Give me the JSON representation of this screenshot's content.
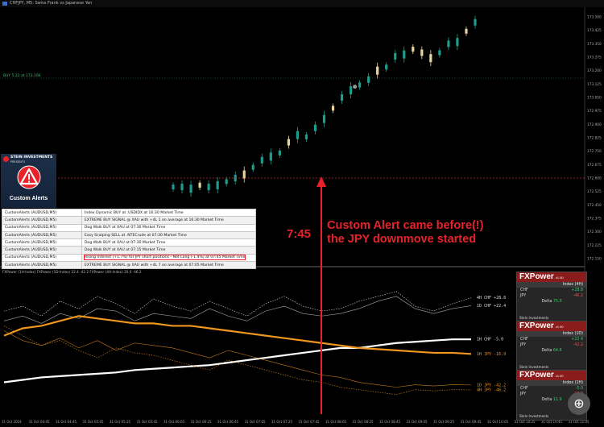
{
  "window_title": "CHFJPY, M5: Swiss Frank vs Japanese Yen",
  "price_label_buy": "BUY 5.22 at 173.106",
  "price_axis": [
    "173.500",
    "173.425",
    "173.350",
    "173.275",
    "173.200",
    "173.125",
    "173.050",
    "172.975",
    "172.900",
    "172.825",
    "172.750",
    "172.675",
    "172.600",
    "172.525",
    "172.450",
    "172.375",
    "172.300",
    "172.225",
    "172.150"
  ],
  "price_axis_values": [
    173.5,
    173.425,
    173.35,
    173.275,
    173.2,
    173.125,
    173.05,
    172.975,
    172.9,
    172.825,
    172.75,
    172.675,
    172.6,
    172.525,
    172.45,
    172.375,
    172.3,
    172.225,
    172.15
  ],
  "logo": {
    "brand": "STEIN INVESTMENTS",
    "sub": "PRESENTS",
    "label": "Custom Alerts"
  },
  "alerts": [
    {
      "source": "CustomAlerts (AUDUSD,M5)",
      "message": "Index Dynamic BUY at .USDIDX at 16:30 Market Time"
    },
    {
      "source": "CustomAlerts (AUDUSD,M5)",
      "message": "EXTREME BUY SIGNAL @ XAU with +4L 1 on average at 16:30 Market Time"
    },
    {
      "source": "CustomAlerts (AUDUSD,M5)",
      "message": "Dog Walk BUY at XAU at 07:30 Market Time"
    },
    {
      "source": "CustomAlerts (AUDUSD,M5)",
      "message": "Easy Scalping SELL at .NTECrude at 07:30 Market Time"
    },
    {
      "source": "CustomAlerts (AUDUSD,M5)",
      "message": "Dog Walk BUY at XAU at 07:30 Market Time"
    },
    {
      "source": "CustomAlerts (AUDUSD,M5)",
      "message": "Dog Walk BUY at XAU at 07:15 Market Time"
    },
    {
      "source": "CustomAlerts (AUDUSD,M5)",
      "message": "Rising Interest (+1.7%) for JPY short positions - Net Long (-1.4%) at 07:45 Market Time"
    },
    {
      "source": "CustomAlerts (AUDUSD,M5)",
      "message": "EXTREME BUY SIGNAL @ XAU with +4L 7 on average at 07:05 Market Time"
    }
  ],
  "annotation": {
    "time": "7:45",
    "line1": "Custom Alert came before(!)",
    "line2": "the JPY downmove started"
  },
  "indicator_header": "FXPower (1H-Index) FXPower (1D-Index) 22.4 -42.2 FXPower (4H-Index) 20.0 -46.2",
  "line_labels": [
    {
      "text": "4H CHF +28.8",
      "y": 28.8
    },
    {
      "text": "1D CHF +22.4",
      "y": 22.4
    },
    {
      "text": "1H CHF  -5.0",
      "y": -5.0
    },
    {
      "text": "1H JPY -16.9",
      "y": -16.9
    },
    {
      "text": "1D JPY -42.2",
      "y": -42.2
    },
    {
      "text": "4H JPY -46.2",
      "y": -46.2
    }
  ],
  "panels": [
    {
      "title": "FXPower",
      "ver": "v1.00",
      "tf_label": "Index (4H)",
      "chf": "+28.8",
      "jpy": "-46.2",
      "delta": "75.0",
      "foot": "Stein Investments"
    },
    {
      "title": "FXPower",
      "ver": "v1.00",
      "tf_label": "Index (1D)",
      "chf": "+22.4",
      "jpy": "-42.2",
      "delta": "64.6",
      "foot": "Stein Investments"
    },
    {
      "title": "FXPower",
      "ver": "v1.00",
      "tf_label": "Index (1H)",
      "chf": "-5.0",
      "jpy": "-16.9",
      "delta": "11.9",
      "foot": "Stein Investments"
    }
  ],
  "time_axis": [
    "31 Oct 2024",
    "31 Oct 04:05",
    "31 Oct 04:45",
    "31 Oct 05:05",
    "31 Oct 05:25",
    "31 Oct 05:45",
    "31 Oct 06:05",
    "31 Oct 06:25",
    "31 Oct 06:45",
    "31 Oct 07:05",
    "31 Oct 07:25",
    "31 Oct 07:45",
    "31 Oct 08:05",
    "31 Oct 08:25",
    "31 Oct 08:45",
    "31 Oct 09:05",
    "31 Oct 09:25",
    "31 Oct 09:45",
    "31 Oct 10:05",
    "31 Oct 10:25",
    "31 Oct 10:45",
    "31 Oct 11:05"
  ],
  "colors": {
    "bull": "#1f9d8c",
    "bear": "#e8d39a",
    "accent": "#e8222a",
    "chf": "#ffffff",
    "jpy": "#f0961e"
  },
  "chart_data": {
    "type": "line",
    "title": "CHFJPY, M5: Swiss Frank vs Japanese Yen",
    "ylim": [
      172.15,
      173.5
    ],
    "candles_mid": [
      172.55,
      172.55,
      172.54,
      172.56,
      172.55,
      172.56,
      172.58,
      172.6,
      172.62,
      172.66,
      172.7,
      172.72,
      172.74,
      172.8,
      172.84,
      172.83,
      172.88,
      172.93,
      172.99,
      173.05,
      173.09,
      173.12,
      173.15,
      173.2,
      173.22,
      173.28,
      173.29,
      173.32,
      173.3,
      173.27,
      173.3,
      173.35,
      173.36,
      173.42,
      173.47
    ],
    "series": [
      {
        "name": "4H CHF",
        "values": [
          18,
          22,
          14,
          26,
          20,
          30,
          24,
          16,
          28,
          22,
          18,
          26,
          20,
          14,
          24,
          30,
          22,
          18,
          20,
          26,
          30,
          34,
          22,
          18,
          24,
          28.8
        ]
      },
      {
        "name": "1D CHF",
        "values": [
          10,
          14,
          8,
          16,
          12,
          20,
          18,
          10,
          16,
          14,
          12,
          20,
          14,
          10,
          18,
          22,
          16,
          14,
          16,
          20,
          26,
          30,
          20,
          16,
          20,
          22.4
        ]
      },
      {
        "name": "1H CHF",
        "values": [
          -40,
          -38,
          -36,
          -35,
          -34,
          -33,
          -32,
          -30,
          -29,
          -28,
          -27,
          -26,
          -24,
          -22,
          -20,
          -18,
          -16,
          -14,
          -12,
          -12,
          -10,
          -8,
          -7,
          -6,
          -5,
          -5
        ]
      },
      {
        "name": "1H JPY",
        "values": [
          -2,
          4,
          6,
          10,
          14,
          12,
          10,
          8,
          8,
          6,
          6,
          4,
          2,
          0,
          -2,
          -4,
          -6,
          -8,
          -10,
          -12,
          -13,
          -14,
          -15,
          -16,
          -16,
          -16.9
        ]
      },
      {
        "name": "1D JPY",
        "values": [
          2,
          -6,
          -10,
          -4,
          -12,
          -6,
          -14,
          -8,
          -10,
          -12,
          -16,
          -20,
          -14,
          -18,
          -22,
          -26,
          -30,
          -34,
          -36,
          -40,
          -42,
          -44,
          -42,
          -43,
          -42,
          -42.2
        ]
      },
      {
        "name": "4H JPY",
        "values": [
          6,
          -2,
          -10,
          -6,
          -14,
          -20,
          -12,
          -16,
          -18,
          -22,
          -26,
          -30,
          -22,
          -26,
          -30,
          -34,
          -38,
          -40,
          -44,
          -46,
          -48,
          -50,
          -46,
          -47,
          -46,
          -46.2
        ]
      }
    ],
    "indicator_ylim": [
      -60,
      45
    ]
  }
}
